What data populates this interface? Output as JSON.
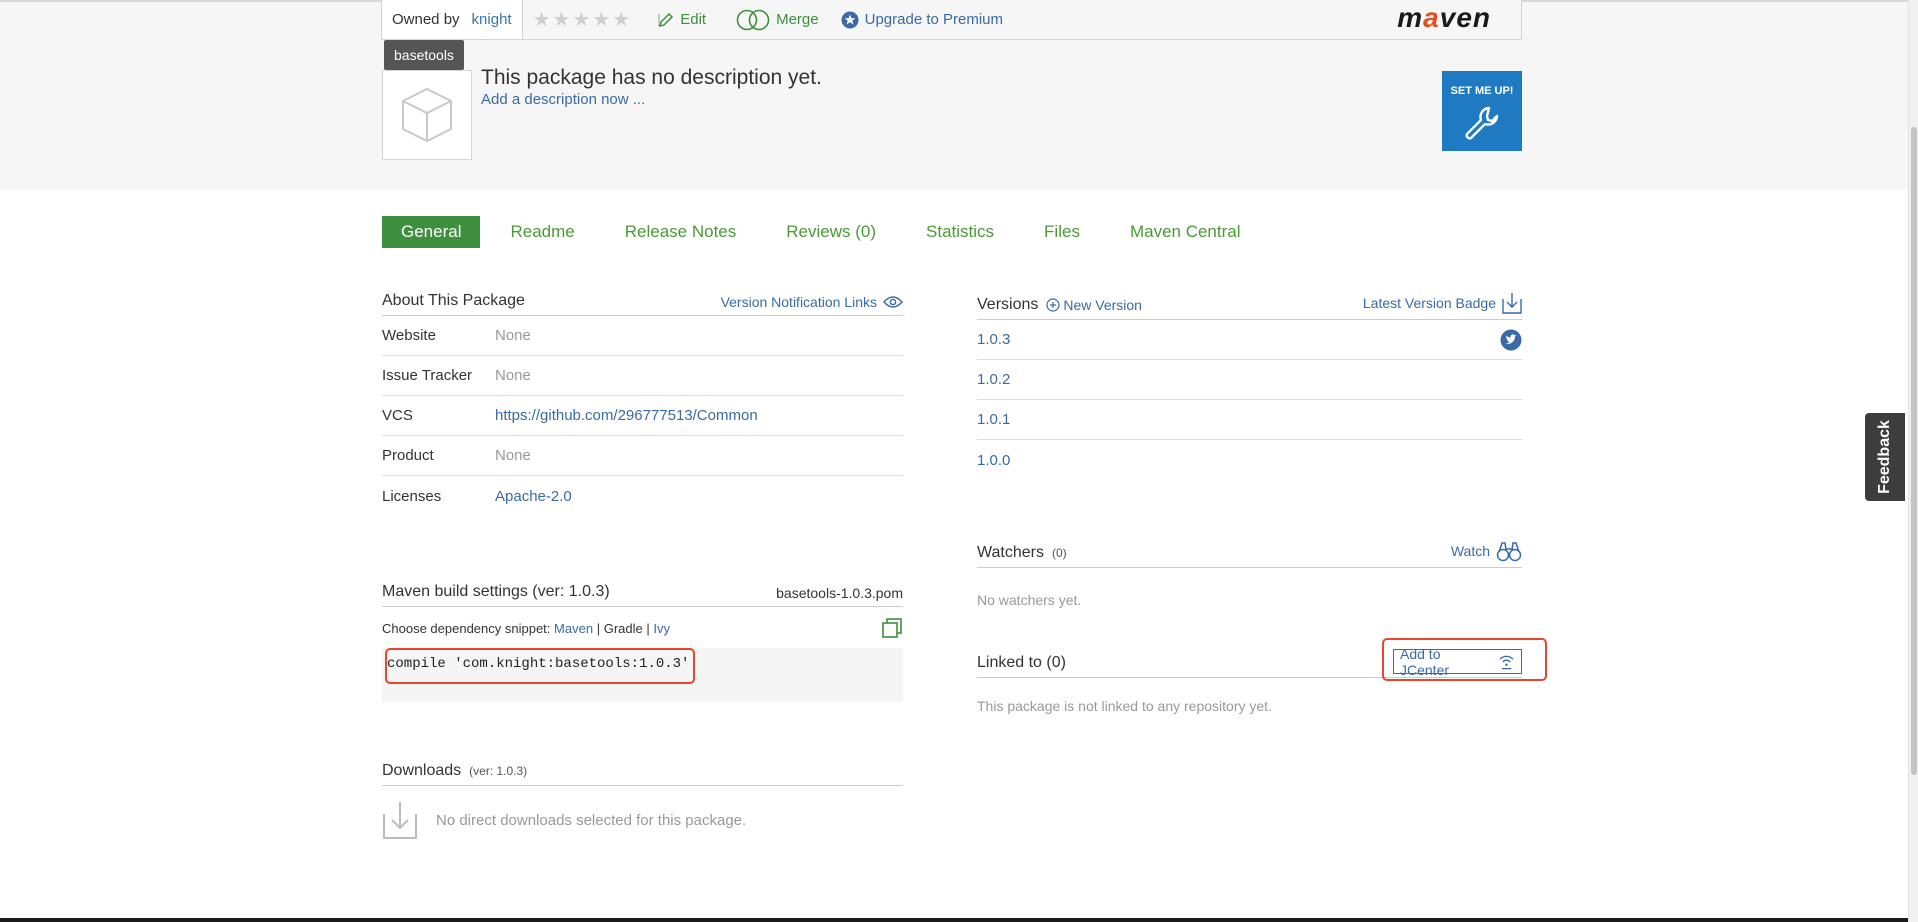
{
  "header": {
    "owned_by_label": "Owned by",
    "owner": "knight",
    "edit_label": "Edit",
    "merge_label": "Merge",
    "upgrade_label": "Upgrade to Premium",
    "logo_prefix": "m",
    "logo_accent": "a",
    "logo_suffix": "ven",
    "rating": 0
  },
  "package": {
    "name": "basetools",
    "description": "This package has no description yet.",
    "add_description": "Add a description now ...",
    "set_me_up": "SET ME UP!"
  },
  "tabs": [
    {
      "label": "General",
      "active": true
    },
    {
      "label": "Readme"
    },
    {
      "label": "Release Notes"
    },
    {
      "label": "Reviews (0)"
    },
    {
      "label": "Statistics"
    },
    {
      "label": "Files"
    },
    {
      "label": "Maven Central"
    }
  ],
  "about": {
    "title": "About This Package",
    "notification_links": "Version Notification Links",
    "rows": [
      {
        "key": "Website",
        "value": "None"
      },
      {
        "key": "Issue Tracker",
        "value": "None"
      },
      {
        "key": "VCS",
        "value": "https://github.com/296777513/Common"
      },
      {
        "key": "Product",
        "value": "None"
      },
      {
        "key": "Licenses",
        "value": "Apache-2.0"
      }
    ]
  },
  "build": {
    "title": "Maven build settings (ver: 1.0.3)",
    "pom_file": "basetools-1.0.3.pom",
    "choose_label": "Choose dependency snippet:",
    "options": [
      "Maven",
      "Gradle",
      "Ivy"
    ],
    "separator": "|",
    "snippet": "compile 'com.knight:basetools:1.0.3'"
  },
  "downloads": {
    "title": "Downloads",
    "ver": "(ver: 1.0.3)",
    "empty": "No direct downloads selected for this package."
  },
  "versions": {
    "title": "Versions",
    "new_version": "New Version",
    "badge": "Latest Version Badge",
    "items": [
      "1.0.3",
      "1.0.2",
      "1.0.1",
      "1.0.0"
    ]
  },
  "watchers": {
    "title": "Watchers",
    "count": "(0)",
    "watch": "Watch",
    "empty": "No watchers yet."
  },
  "linked": {
    "title": "Linked to (0)",
    "add_jcenter": "Add to JCenter",
    "empty": "This package is not linked to any repository yet."
  },
  "feedback": "Feedback",
  "colors": {
    "accent_green": "#3e8f3e",
    "link_blue": "#3a6aa6",
    "highlight_red": "#e8462a",
    "setme_blue": "#1f7ac2"
  }
}
